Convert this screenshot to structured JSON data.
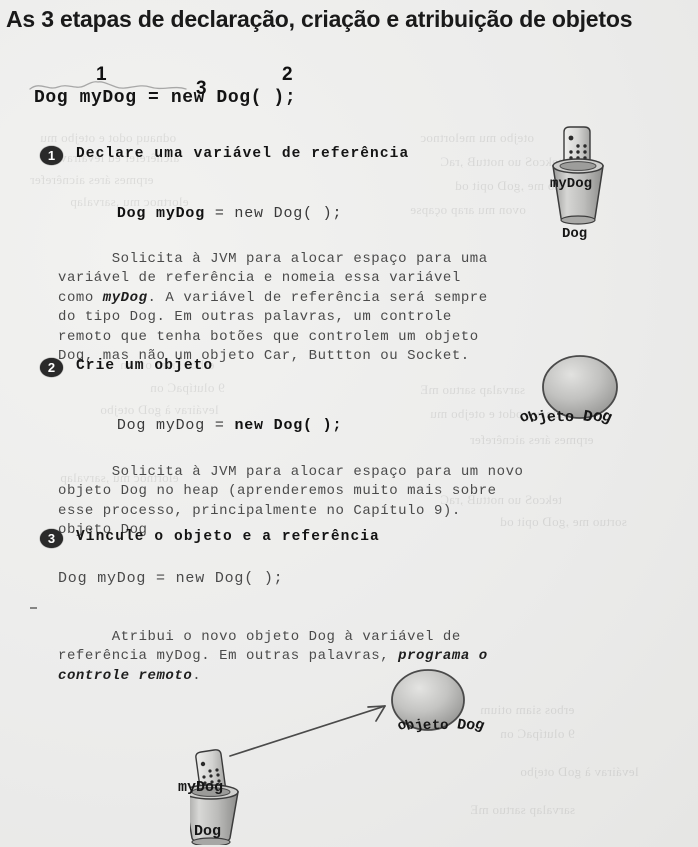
{
  "title": "As 3 etapas de declaração, criação e atribuição de objetos",
  "top_code": {
    "text": "Dog myDog = new Dog( );",
    "annotations": [
      {
        "num": "1",
        "target": "Dog myDog"
      },
      {
        "num": "3",
        "target": "="
      },
      {
        "num": "2",
        "target": "new Dog( );"
      }
    ]
  },
  "steps": [
    {
      "badge": "1",
      "heading": "Declare uma variável de referência",
      "code_bold": "Dog myDog",
      "code_rest": " = new Dog( );",
      "paragraph_lines": [
        "Solicita à JVM para alocar espaço para uma",
        "variável de referência e nomeia essa variável",
        "como myDog. A variável de referência será sempre",
        "do tipo Dog. Em outras palavras, um controle",
        "remoto que tenha botões que controlem um objeto",
        "Dog, mas não um objeto Car, Buttton ou Socket."
      ],
      "emphasis": "myDog"
    },
    {
      "badge": "2",
      "heading": "Crie um objeto",
      "code_plain": "Dog myDog = ",
      "code_bold": "new Dog( );",
      "paragraph_lines": [
        "Solicita à JVM para alocar espaço para um novo",
        "objeto Dog no heap (aprenderemos muito mais sobre",
        "esse processo, principalmente no Capítulo 9).",
        "objeto Dog"
      ]
    },
    {
      "badge": "3",
      "heading": "Vincule o objeto e a referência",
      "code_plain": "Dog myDog = new Dog( );",
      "paragraph_lines": [
        "Atribui o novo objeto Dog à variável de",
        "referência myDog. Em outras palavras, programa o",
        "controle remoto."
      ],
      "emphasis": "programa o controle remoto"
    }
  ],
  "illustrations": {
    "remote_in_cup_top": {
      "name": "remote-control-in-cup",
      "cup_label": "myDog",
      "type_label": "Dog"
    },
    "sphere_middle": {
      "name": "dog-object-sphere",
      "label": "objeto Dog"
    },
    "bottom_diagram": {
      "name": "reference-assignment-diagram",
      "cup_label": "myDog",
      "type_label": "Dog",
      "sphere_label": "objeto Dog",
      "arrow": "reference-arrow"
    }
  },
  "ghost_text": [
    "odnauq odot e otejbo mu",
    "aicnêrefer ed leváirav",
    "erpmes áres aicnêrefer",
    "elortnoc mu ,sarvalap",
    "otejbo mu melortnoc",
    "tekcoS uo nottuB ,raC",
    "sortuo me ,goD opit od",
    "ovon mu arap oçapse",
    "erbos siam otium",
    "9 olutípaC on",
    "leváirav à goD otejbo",
    "sarvalap sartuo mE"
  ],
  "colors": {
    "page_background": "#ececea",
    "ink": "#1b1b1b",
    "code_ink": "#4a4a4a",
    "badge": "#2a2a2a"
  }
}
